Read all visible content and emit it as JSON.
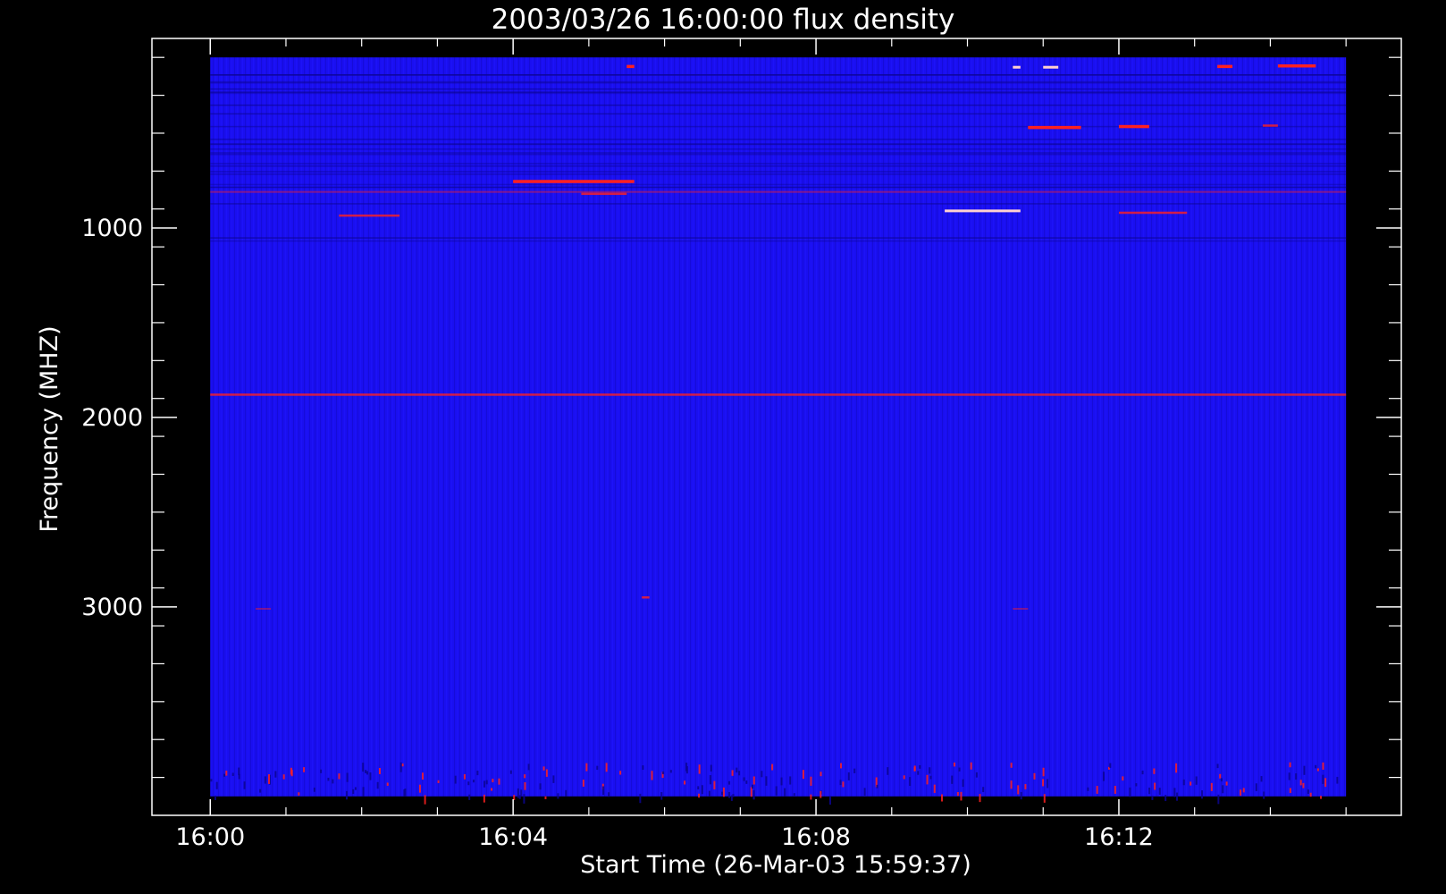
{
  "chart_data": {
    "type": "heatmap",
    "title": "2003/03/26 16:00:00 flux density",
    "xlabel": "Start Time (26-Mar-03 15:59:37)",
    "ylabel": "Frequency (MHZ)",
    "x_tick_labels": [
      "16:00",
      "16:04",
      "16:08",
      "16:12"
    ],
    "x_tick_minutes": [
      0,
      4,
      8,
      12
    ],
    "xlim_minutes": [
      -0.77,
      15.73
    ],
    "y_tick_labels": [
      "1000",
      "2000",
      "3000"
    ],
    "y_tick_values": [
      1000,
      2000,
      3000
    ],
    "ylim": [
      0,
      4100
    ],
    "ylim_inverted": true,
    "data_extent_minutes": [
      0,
      15
    ],
    "data_extent_mhz": [
      100,
      4000
    ],
    "colors": {
      "background": "#000000",
      "field": "#1a0ff0",
      "field_dark": "#0c0590",
      "burst": "#ff2020",
      "burst_bright": "#ffd0d0"
    },
    "features": [
      {
        "t0": 4.0,
        "t1": 5.6,
        "f": 755,
        "level": "high"
      },
      {
        "t0": 4.9,
        "t1": 5.5,
        "f": 820,
        "level": "med"
      },
      {
        "t0": 10.8,
        "t1": 11.5,
        "f": 470,
        "level": "high"
      },
      {
        "t0": 12.0,
        "t1": 12.4,
        "f": 465,
        "level": "high"
      },
      {
        "t0": 14.1,
        "t1": 14.6,
        "f": 145,
        "level": "high"
      },
      {
        "t0": 13.3,
        "t1": 13.5,
        "f": 148,
        "level": "high"
      },
      {
        "t0": 5.5,
        "t1": 5.6,
        "f": 148,
        "level": "high"
      },
      {
        "t0": 11.0,
        "t1": 11.2,
        "f": 152,
        "level": "bright"
      },
      {
        "t0": 10.6,
        "t1": 10.7,
        "f": 152,
        "level": "bright"
      },
      {
        "t0": 1.7,
        "t1": 2.5,
        "f": 935,
        "level": "med"
      },
      {
        "t0": 9.7,
        "t1": 10.7,
        "f": 910,
        "level": "bright"
      },
      {
        "t0": 12.0,
        "t1": 12.9,
        "f": 920,
        "level": "med"
      },
      {
        "t0": 0.0,
        "t1": 15.0,
        "f": 1880,
        "level": "med"
      },
      {
        "t0": 0.0,
        "t1": 15.0,
        "f": 810,
        "level": "low"
      },
      {
        "t0": 13.9,
        "t1": 14.1,
        "f": 460,
        "level": "med"
      },
      {
        "t0": 5.7,
        "t1": 5.8,
        "f": 2950,
        "level": "med"
      },
      {
        "t0": 0.6,
        "t1": 0.8,
        "f": 3010,
        "level": "low"
      },
      {
        "t0": 10.6,
        "t1": 10.8,
        "f": 3010,
        "level": "low"
      }
    ]
  }
}
